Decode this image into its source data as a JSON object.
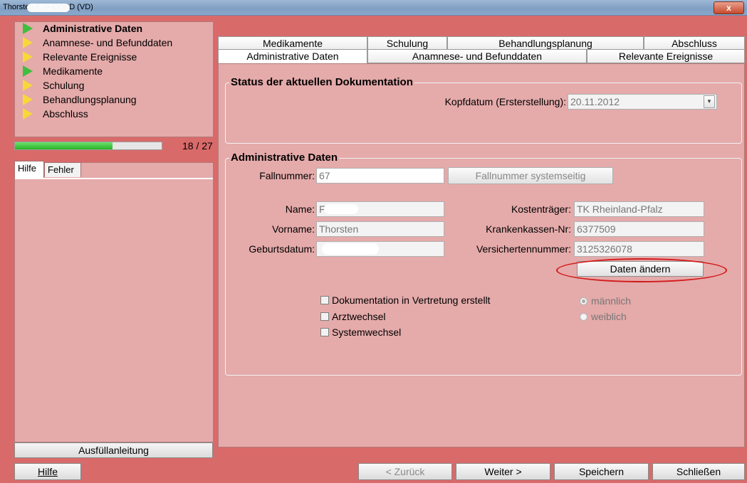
{
  "window": {
    "title": "Thorsten F             -> COPD (VD)",
    "close_glyph": "x"
  },
  "steps": [
    {
      "label": "Administrative Daten",
      "icon": "green",
      "bold": true
    },
    {
      "label": "Anamnese- und Befunddaten",
      "icon": "yellow"
    },
    {
      "label": "Relevante Ereignisse",
      "icon": "yellow"
    },
    {
      "label": "Medikamente",
      "icon": "green"
    },
    {
      "label": "Schulung",
      "icon": "yellow"
    },
    {
      "label": "Behandlungsplanung",
      "icon": "yellow"
    },
    {
      "label": "Abschluss",
      "icon": "yellow"
    }
  ],
  "progress": {
    "label": "18 / 27",
    "fraction": 0.666
  },
  "help_tabs": {
    "hilfe": "Hilfe",
    "fehler": "Fehler"
  },
  "ausfuell_button": "Ausfüllanleitung",
  "main_tabs_row1": [
    "Medikamente",
    "Schulung",
    "Behandlungsplanung",
    "Abschluss"
  ],
  "main_tabs_row2": [
    "Administrative Daten",
    "Anamnese- und Befunddaten",
    "Relevante Ereignisse"
  ],
  "status_group": {
    "title": "Status der aktuellen Dokumentation",
    "kopfdatum_label": "Kopfdatum (Ersterstellung):",
    "kopfdatum_value": "20.11.2012"
  },
  "admin_group": {
    "title": "Administrative Daten",
    "fallnummer_label": "Fallnummer:",
    "fallnummer_value": "67",
    "fallnummer_button": "Fallnummer systemseitig",
    "name_label": "Name:",
    "name_value": "F",
    "vorname_label": "Vorname:",
    "vorname_value": "Thorsten",
    "geburtsdatum_label": "Geburtsdatum:",
    "geburtsdatum_value": "",
    "kostentraeger_label": "Kostenträger:",
    "kostentraeger_value": "TK Rheinland-Pfalz",
    "krankenkassen_label": "Krankenkassen-Nr:",
    "krankenkassen_value": "6377509",
    "versicherten_label": "Versichertennummer:",
    "versicherten_value": "3125326078",
    "daten_aendern_button": "Daten ändern",
    "checkboxes": [
      "Dokumentation in Vertretung erstellt",
      "Arztwechsel",
      "Systemwechsel"
    ],
    "gender_options": [
      "männlich",
      "weiblich"
    ]
  },
  "bottom_nav": {
    "hilfe": "Hilfe",
    "zurueck": "< Zurück",
    "weiter": "Weiter >",
    "speichern": "Speichern",
    "schliessen": "Schließen"
  }
}
